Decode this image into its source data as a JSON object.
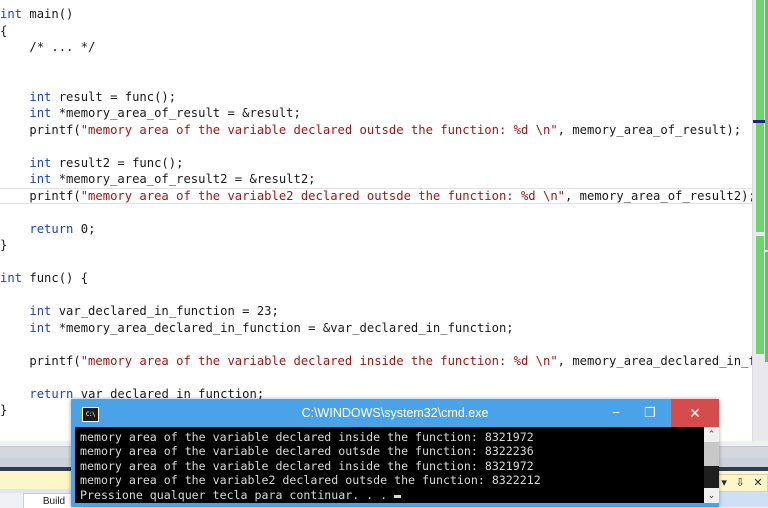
{
  "editor": {
    "language": "c",
    "fold_placeholder": "/* ... */",
    "lines": [
      "int main()",
      "{",
      "__FOLD__",
      "",
      "",
      "    int result = func();",
      "    int *memory_area_of_result = &result;",
      "    printf(\"memory area of the variable declared outsde the function: %d \\n\", memory_area_of_result);",
      "",
      "    int result2 = func();",
      "    int *memory_area_of_result2 = &result2;",
      "    printf(\"memory area of the variable2 declared outsde the function: %d \\n\", memory_area_of_result2);",
      "",
      "    return 0;",
      "}",
      "",
      "int func() {",
      "",
      "    int var_declared_in_function = 23;",
      "    int *memory_area_declared_in_function = &var_declared_in_function;",
      "",
      "    printf(\"memory area of the variable declared inside the function: %d \\n\", memory_area_declared_in_function)",
      "",
      "    return var_declared_in_function;",
      "}"
    ],
    "current_line_index": 11,
    "colors": {
      "keyword": "#1f3fbf",
      "string": "#a31515",
      "plain": "#1a1a1a",
      "background": "#ffffff",
      "scrollbar_marker_green": "#6fd46f",
      "scrollbar_caret": "#202080"
    }
  },
  "bottom_panel": {
    "tab_label": "Build",
    "dropdown_icon": "chevron-down-icon",
    "pin_icon": "pin-icon",
    "close_icon": "close-icon",
    "dropdown_glyph": "▾",
    "pin_glyph": "⇩",
    "close_glyph": "✕"
  },
  "console": {
    "title": "C:\\WINDOWS\\system32\\cmd.exe",
    "icon_label": "C:\\",
    "minimize_glyph": "−",
    "maximize_glyph": "❐",
    "close_glyph": "✕",
    "scroll_up_glyph": "⌃",
    "scroll_down_glyph": "⌄",
    "title_bar_color": "#4aa3e8",
    "close_button_color": "#d64c4c",
    "background": "#000000",
    "text_color": "#d8d8d8",
    "output_lines": [
      "memory area of the variable declared inside the function: 8321972",
      "memory area of the variable declared outsde the function: 8322236",
      "memory area of the variable declared inside the function: 8321972",
      "memory area of the variable2 declared outsde the function: 8322212",
      "Pressione qualquer tecla para continuar. . ."
    ]
  }
}
